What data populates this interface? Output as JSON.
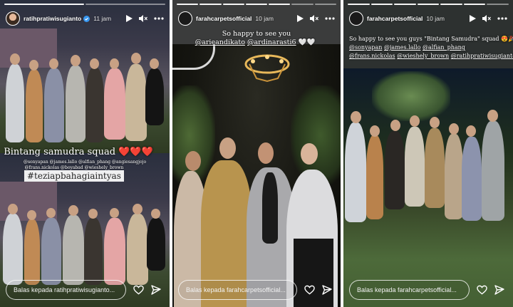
{
  "stories": [
    {
      "username": "ratihpratiwisugianto",
      "verified": true,
      "time": "11 jam",
      "caption_title": "Bintang samudra squad",
      "caption_hearts": "❤️❤️❤️",
      "mentions": [
        "@sonyapan @james.lallo @alfian_phang @angiesangjojo",
        "@frans.nickolas @boyabad @wieshely_brown"
      ],
      "hashtag": "#teziapbahagiaintyas",
      "reply_placeholder": "Balas kepada ratihpratiwisugianto..."
    },
    {
      "username": "farahcarpetsofficial",
      "verified": false,
      "time": "10 jam",
      "caption_title": "So happy to see you",
      "mentions": [
        "@arieandikato",
        "@ardinarasti6"
      ],
      "hearts": "🤍🤍",
      "reply_placeholder": "Balas kepada farahcarpetsofficial..."
    },
    {
      "username": "farahcarpetsofficial",
      "verified": false,
      "time": "10 jam",
      "caption_title": "So happy to see you guys \"Bintang Samudra\" squad",
      "caption_emoji": "😍🎉",
      "mentions": [
        "@sonyapan",
        "@james.lallo",
        "@alfian_phang",
        "@frans.nickolas",
        "@wieshely_brown",
        "@ratihpratiwisugianto"
      ],
      "reply_placeholder": "Balas kepada farahcarpetsofficial..."
    }
  ],
  "icons": [
    "play-icon",
    "mute-icon",
    "more-icon",
    "heart-icon",
    "send-icon",
    "verified-icon"
  ]
}
